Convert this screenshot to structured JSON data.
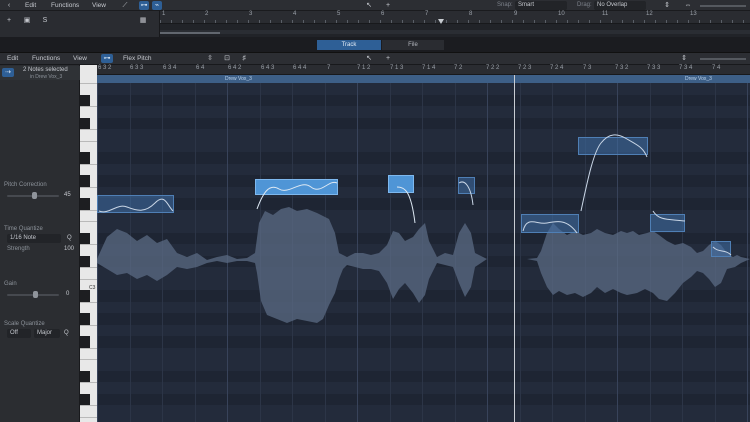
{
  "topbar": {
    "menus": [
      "Edit",
      "Functions",
      "View"
    ],
    "snap_label": "Snap:",
    "snap_value": "Smart",
    "drag_label": "Drag:",
    "drag_value": "No Overlap"
  },
  "global_ruler": [
    "1",
    "2",
    "3",
    "4",
    "5",
    "6",
    "7",
    "8",
    "9",
    "10",
    "11",
    "12",
    "13"
  ],
  "tabs": {
    "track": "Track",
    "file": "File"
  },
  "editor_toolbar": {
    "menus": [
      "Edit",
      "Functions",
      "View"
    ],
    "mode": "Flex Pitch"
  },
  "inspector": {
    "selection_title": "2 Notes selected",
    "selection_sub": "in Drew Vox_3",
    "pitch_correction_label": "Pitch Correction",
    "pitch_correction_value": "45",
    "time_quantize_label": "Time Quantize",
    "time_quantize_value": "1/16 Note",
    "time_quantize_q": "Q",
    "strength_label": "Strength",
    "strength_value": "100",
    "gain_label": "Gain",
    "gain_value": "0",
    "scale_quantize_label": "Scale Quantize",
    "scale_off": "Off",
    "scale_major": "Major",
    "scale_q": "Q"
  },
  "editor_ruler": [
    "6 3 2",
    "6 3 3",
    "6 3 4",
    "6 4",
    "6 4 2",
    "6 4 3",
    "6 4 4",
    "7",
    "7 1 2",
    "7 1 3",
    "7 1 4",
    "7 2",
    "7 2 2",
    "7 2 3",
    "7 2 4",
    "7 3",
    "7 3 2",
    "7 3 3",
    "7 3 4",
    "7 4"
  ],
  "regions": [
    "Drew Vox_3",
    "Drew Vox_3"
  ],
  "piano_label": "C3",
  "colors": {
    "accent": "#2e5f96",
    "note_selected": "#4f95d6",
    "grid": "#232b3b"
  }
}
